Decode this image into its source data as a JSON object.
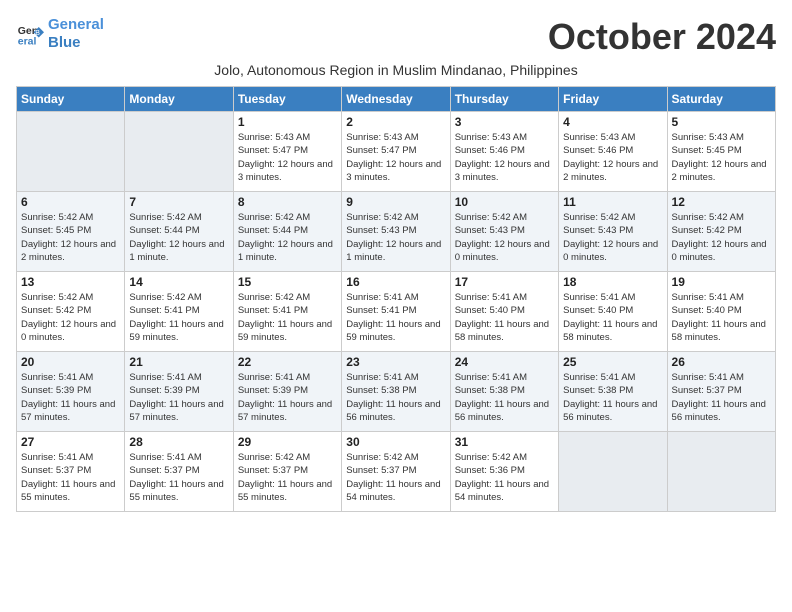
{
  "header": {
    "logo_line1": "General",
    "logo_line2": "Blue",
    "month": "October 2024",
    "subtitle": "Jolo, Autonomous Region in Muslim Mindanao, Philippines"
  },
  "weekdays": [
    "Sunday",
    "Monday",
    "Tuesday",
    "Wednesday",
    "Thursday",
    "Friday",
    "Saturday"
  ],
  "weeks": [
    [
      {
        "day": "",
        "info": ""
      },
      {
        "day": "",
        "info": ""
      },
      {
        "day": "1",
        "info": "Sunrise: 5:43 AM\nSunset: 5:47 PM\nDaylight: 12 hours and 3 minutes."
      },
      {
        "day": "2",
        "info": "Sunrise: 5:43 AM\nSunset: 5:47 PM\nDaylight: 12 hours and 3 minutes."
      },
      {
        "day": "3",
        "info": "Sunrise: 5:43 AM\nSunset: 5:46 PM\nDaylight: 12 hours and 3 minutes."
      },
      {
        "day": "4",
        "info": "Sunrise: 5:43 AM\nSunset: 5:46 PM\nDaylight: 12 hours and 2 minutes."
      },
      {
        "day": "5",
        "info": "Sunrise: 5:43 AM\nSunset: 5:45 PM\nDaylight: 12 hours and 2 minutes."
      }
    ],
    [
      {
        "day": "6",
        "info": "Sunrise: 5:42 AM\nSunset: 5:45 PM\nDaylight: 12 hours and 2 minutes."
      },
      {
        "day": "7",
        "info": "Sunrise: 5:42 AM\nSunset: 5:44 PM\nDaylight: 12 hours and 1 minute."
      },
      {
        "day": "8",
        "info": "Sunrise: 5:42 AM\nSunset: 5:44 PM\nDaylight: 12 hours and 1 minute."
      },
      {
        "day": "9",
        "info": "Sunrise: 5:42 AM\nSunset: 5:43 PM\nDaylight: 12 hours and 1 minute."
      },
      {
        "day": "10",
        "info": "Sunrise: 5:42 AM\nSunset: 5:43 PM\nDaylight: 12 hours and 0 minutes."
      },
      {
        "day": "11",
        "info": "Sunrise: 5:42 AM\nSunset: 5:43 PM\nDaylight: 12 hours and 0 minutes."
      },
      {
        "day": "12",
        "info": "Sunrise: 5:42 AM\nSunset: 5:42 PM\nDaylight: 12 hours and 0 minutes."
      }
    ],
    [
      {
        "day": "13",
        "info": "Sunrise: 5:42 AM\nSunset: 5:42 PM\nDaylight: 12 hours and 0 minutes."
      },
      {
        "day": "14",
        "info": "Sunrise: 5:42 AM\nSunset: 5:41 PM\nDaylight: 11 hours and 59 minutes."
      },
      {
        "day": "15",
        "info": "Sunrise: 5:42 AM\nSunset: 5:41 PM\nDaylight: 11 hours and 59 minutes."
      },
      {
        "day": "16",
        "info": "Sunrise: 5:41 AM\nSunset: 5:41 PM\nDaylight: 11 hours and 59 minutes."
      },
      {
        "day": "17",
        "info": "Sunrise: 5:41 AM\nSunset: 5:40 PM\nDaylight: 11 hours and 58 minutes."
      },
      {
        "day": "18",
        "info": "Sunrise: 5:41 AM\nSunset: 5:40 PM\nDaylight: 11 hours and 58 minutes."
      },
      {
        "day": "19",
        "info": "Sunrise: 5:41 AM\nSunset: 5:40 PM\nDaylight: 11 hours and 58 minutes."
      }
    ],
    [
      {
        "day": "20",
        "info": "Sunrise: 5:41 AM\nSunset: 5:39 PM\nDaylight: 11 hours and 57 minutes."
      },
      {
        "day": "21",
        "info": "Sunrise: 5:41 AM\nSunset: 5:39 PM\nDaylight: 11 hours and 57 minutes."
      },
      {
        "day": "22",
        "info": "Sunrise: 5:41 AM\nSunset: 5:39 PM\nDaylight: 11 hours and 57 minutes."
      },
      {
        "day": "23",
        "info": "Sunrise: 5:41 AM\nSunset: 5:38 PM\nDaylight: 11 hours and 56 minutes."
      },
      {
        "day": "24",
        "info": "Sunrise: 5:41 AM\nSunset: 5:38 PM\nDaylight: 11 hours and 56 minutes."
      },
      {
        "day": "25",
        "info": "Sunrise: 5:41 AM\nSunset: 5:38 PM\nDaylight: 11 hours and 56 minutes."
      },
      {
        "day": "26",
        "info": "Sunrise: 5:41 AM\nSunset: 5:37 PM\nDaylight: 11 hours and 56 minutes."
      }
    ],
    [
      {
        "day": "27",
        "info": "Sunrise: 5:41 AM\nSunset: 5:37 PM\nDaylight: 11 hours and 55 minutes."
      },
      {
        "day": "28",
        "info": "Sunrise: 5:41 AM\nSunset: 5:37 PM\nDaylight: 11 hours and 55 minutes."
      },
      {
        "day": "29",
        "info": "Sunrise: 5:42 AM\nSunset: 5:37 PM\nDaylight: 11 hours and 55 minutes."
      },
      {
        "day": "30",
        "info": "Sunrise: 5:42 AM\nSunset: 5:37 PM\nDaylight: 11 hours and 54 minutes."
      },
      {
        "day": "31",
        "info": "Sunrise: 5:42 AM\nSunset: 5:36 PM\nDaylight: 11 hours and 54 minutes."
      },
      {
        "day": "",
        "info": ""
      },
      {
        "day": "",
        "info": ""
      }
    ]
  ]
}
